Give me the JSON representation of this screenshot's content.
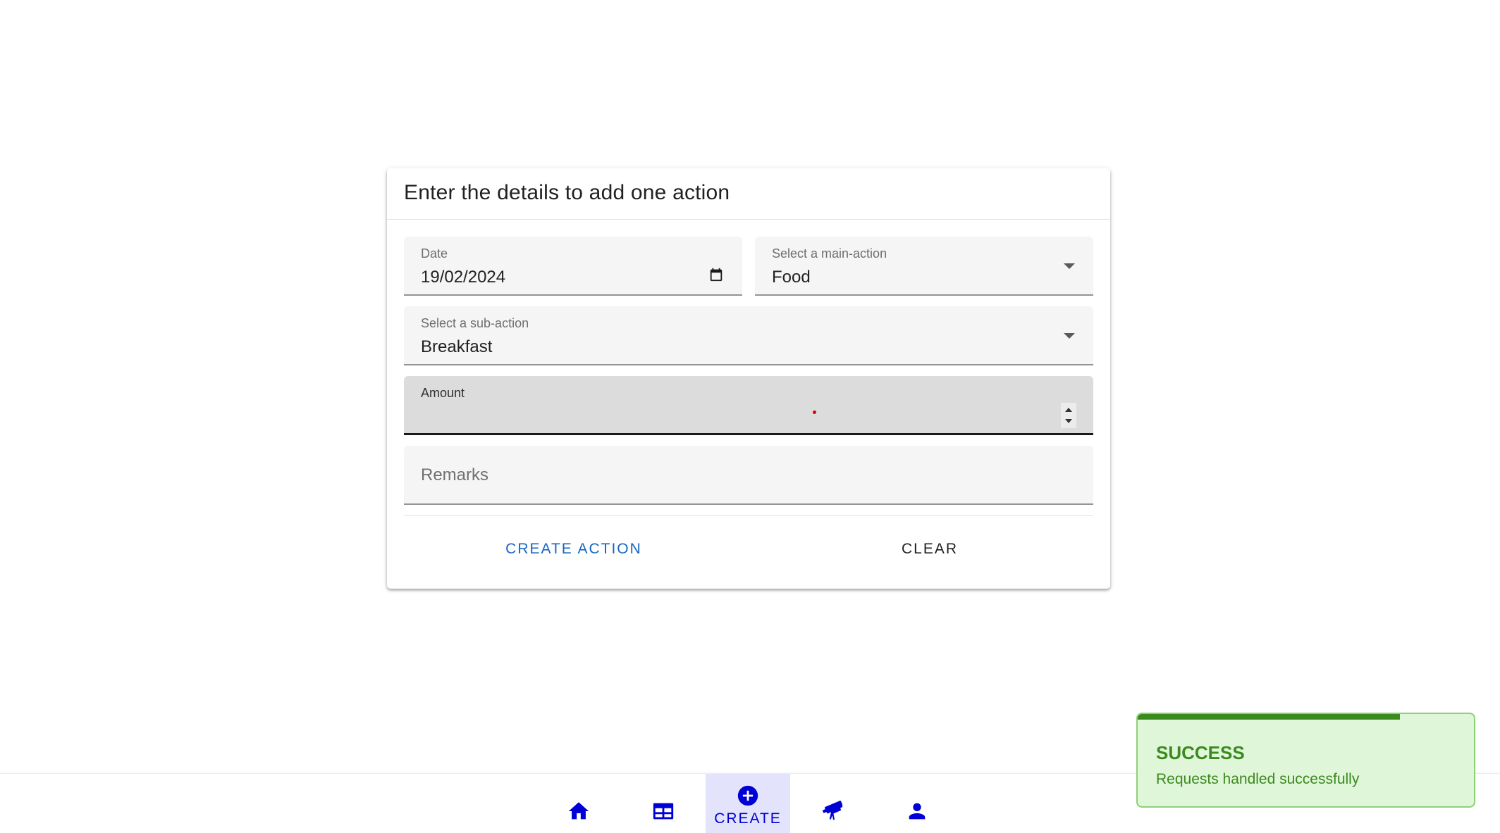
{
  "form": {
    "title": "Enter the details to add one action",
    "date": {
      "label": "Date",
      "value": "19/02/2024"
    },
    "main_action": {
      "label": "Select a main-action",
      "value": "Food"
    },
    "sub_action": {
      "label": "Select a sub-action",
      "value": "Breakfast"
    },
    "amount": {
      "label": "Amount",
      "value": ""
    },
    "remarks": {
      "placeholder": "Remarks",
      "value": ""
    },
    "create_label": "CREATE ACTION",
    "clear_label": "CLEAR"
  },
  "nav": {
    "items": [
      {
        "icon": "home-icon"
      },
      {
        "icon": "table-icon"
      },
      {
        "icon": "add-circle-icon",
        "label": "CREATE",
        "active": true
      },
      {
        "icon": "telescope-icon"
      },
      {
        "icon": "person-icon"
      }
    ]
  },
  "toast": {
    "title": "SUCCESS",
    "message": "Requests handled successfully",
    "progress": 0.78
  },
  "colors": {
    "accent": "#1565c0",
    "nav_icon": "#0000d6",
    "nav_active_bg": "#e3e3fb",
    "success": "#3a8a1e",
    "success_bg": "#e0f6d9"
  }
}
